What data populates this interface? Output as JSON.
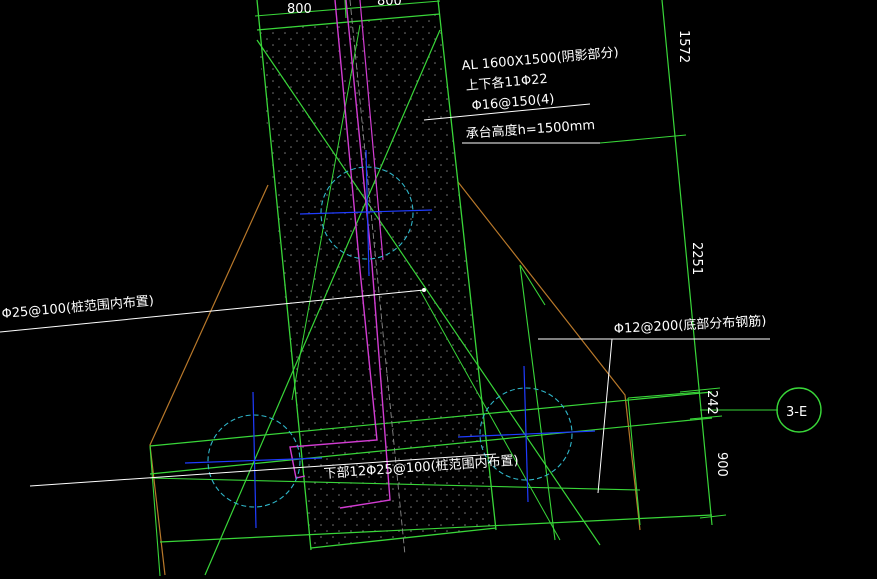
{
  "colors": {
    "background": "#000000",
    "green": "#39d639",
    "magenta": "#d23cd2",
    "orange": "#b8782a",
    "cyan": "#2fb5c8",
    "blue": "#1f3cff",
    "white": "#ffffff",
    "grey": "#8a8a8a"
  },
  "labels": {
    "beam_title": "AL 1600X1500(阴影部分)",
    "beam_top_bottom": "上下各11Φ22",
    "beam_stirrup": "Φ16@150(4)",
    "cap_height": "承台高度h=1500mm",
    "bottom_mesh_left": "Φ25@100(桩范围内布置)",
    "bottom_mesh": "下部12Φ25@100(桩范围内布置)",
    "distribution_bar": "Φ12@200(底部分布钢筋)"
  },
  "dimensions": {
    "top_left": "800",
    "top_right": "800",
    "d1": "1572",
    "d2": "2251",
    "d3": "242",
    "d4": "900"
  },
  "axis": {
    "label": "3-E"
  }
}
